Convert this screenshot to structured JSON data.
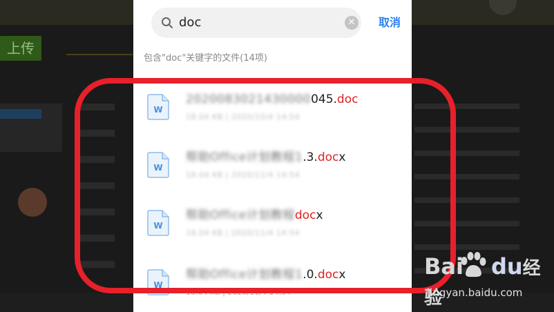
{
  "search": {
    "query": "doc",
    "cancel_label": "取消"
  },
  "results": {
    "summary": "包含\"doc\"关键字的文件(14项)",
    "items": [
      {
        "name_blurred": "2020083021430000",
        "name_visible": "045.",
        "name_match": "doc",
        "name_suffix": "",
        "meta_blurred": "18.04 KB | 2020/10/4 14:54",
        "meta_visible": ""
      },
      {
        "name_blurred": "帮助Office计划教程1",
        "name_visible": ".3.",
        "name_match": "doc",
        "name_suffix": "x",
        "meta_blurred": "18.04 KB | 2020/11/4 14:54",
        "meta_visible": ""
      },
      {
        "name_blurred": "帮助Office计划教程",
        "name_visible": "",
        "name_match": "doc",
        "name_suffix": "x",
        "meta_blurred": "18.04 KB | 2020/11/4 14:54",
        "meta_visible": ""
      },
      {
        "name_blurred": "帮助Office计划教程1",
        "name_visible": ".0.",
        "name_match": "doc",
        "name_suffix": "x",
        "meta_blurred": "",
        "meta_visible": "18.04 KB | 2020/11/4 14:54"
      }
    ]
  },
  "background": {
    "upload_label": "上传"
  },
  "watermark": {
    "logo_bai": "Bai",
    "logo_du": "du",
    "logo_jy": "经验",
    "url": "jingyan.baidu.com"
  },
  "colors": {
    "accent": "#2f80ed",
    "match_highlight": "#e02020",
    "annotation": "#e8202a",
    "doc_icon": "#4a90d9"
  }
}
